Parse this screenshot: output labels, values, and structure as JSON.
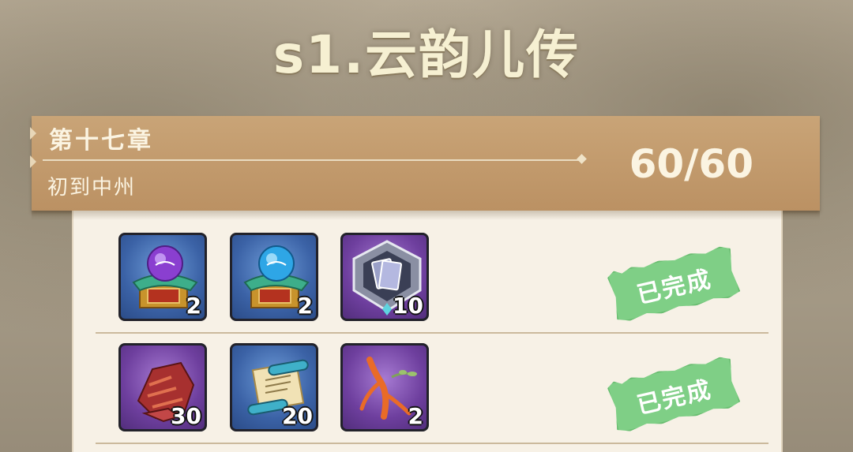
{
  "page": {
    "title": "s1.云韵儿传"
  },
  "chapter": {
    "number_label": "第十七章",
    "name": "初到中州",
    "progress": "60/60"
  },
  "rows": [
    {
      "status": "已完成",
      "items": [
        {
          "icon": "purple-orb-chest-icon",
          "quantity": "2",
          "frame": "blue"
        },
        {
          "icon": "blue-orb-chest-icon",
          "quantity": "2",
          "frame": "blue"
        },
        {
          "icon": "silver-card-emblem-icon",
          "quantity": "10",
          "frame": "purple"
        }
      ]
    },
    {
      "status": "已完成",
      "items": [
        {
          "icon": "red-ore-chunk-icon",
          "quantity": "30",
          "frame": "purple"
        },
        {
          "icon": "scroll-icon",
          "quantity": "20",
          "frame": "blue"
        },
        {
          "icon": "ginseng-root-icon",
          "quantity": "2",
          "frame": "purple"
        }
      ]
    }
  ],
  "colors": {
    "chapter_bar": "#c9a477",
    "panel": "#f7f1e6",
    "stamp_green": "#7fcf86",
    "frame_blue": "#3b62a6",
    "frame_purple": "#6e3f9e"
  }
}
